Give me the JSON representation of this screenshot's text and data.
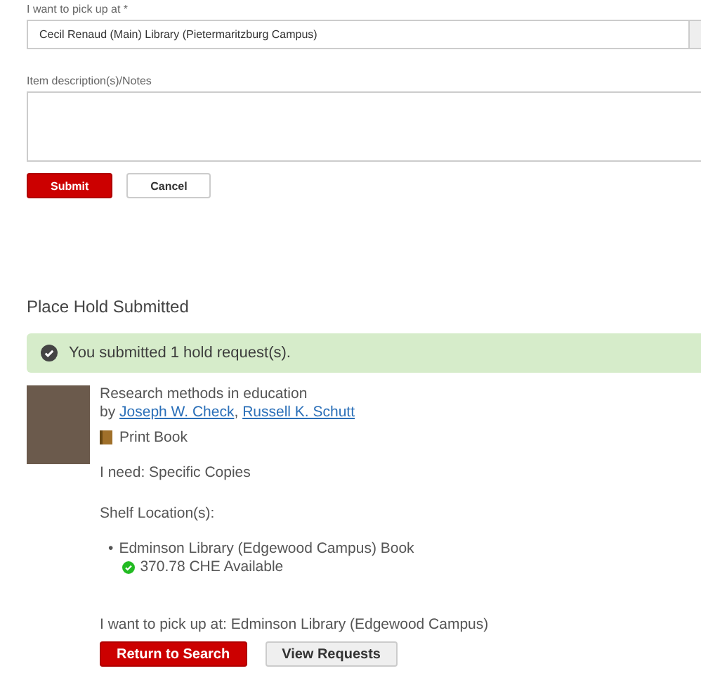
{
  "pickup_form": {
    "pickup_label": "I want to pick up at *",
    "pickup_value": "Cecil Renaud (Main) Library (Pietermaritzburg Campus)",
    "notes_label": "Item description(s)/Notes",
    "buttons": [
      {
        "label": "Submit",
        "kind": "primary"
      },
      {
        "label": "Cancel",
        "kind": "secondary"
      }
    ]
  },
  "result": {
    "heading": "Place Hold Submitted",
    "alert": "You submitted 1 hold request(s).",
    "item": {
      "title": "Research methods in education",
      "by": "by",
      "authors": [
        "Joseph W. Check",
        "Russell K. Schutt"
      ],
      "author_separator": ",",
      "format": "Print Book",
      "need": "I need: Specific Copies",
      "shelf_label": "Shelf Location(s):",
      "locations": [
        {
          "bullet": "•",
          "name": "Edminson Library (Edgewood Campus) Book",
          "call_number": "370.78 CHE Available",
          "available": true
        }
      ],
      "pickup": "I want to pick up at: Edminson Library (Edgewood Campus)"
    },
    "buttons": [
      {
        "label": "Return to Search",
        "kind": "primary"
      },
      {
        "label": "View Requests",
        "kind": "secondary"
      }
    ]
  }
}
